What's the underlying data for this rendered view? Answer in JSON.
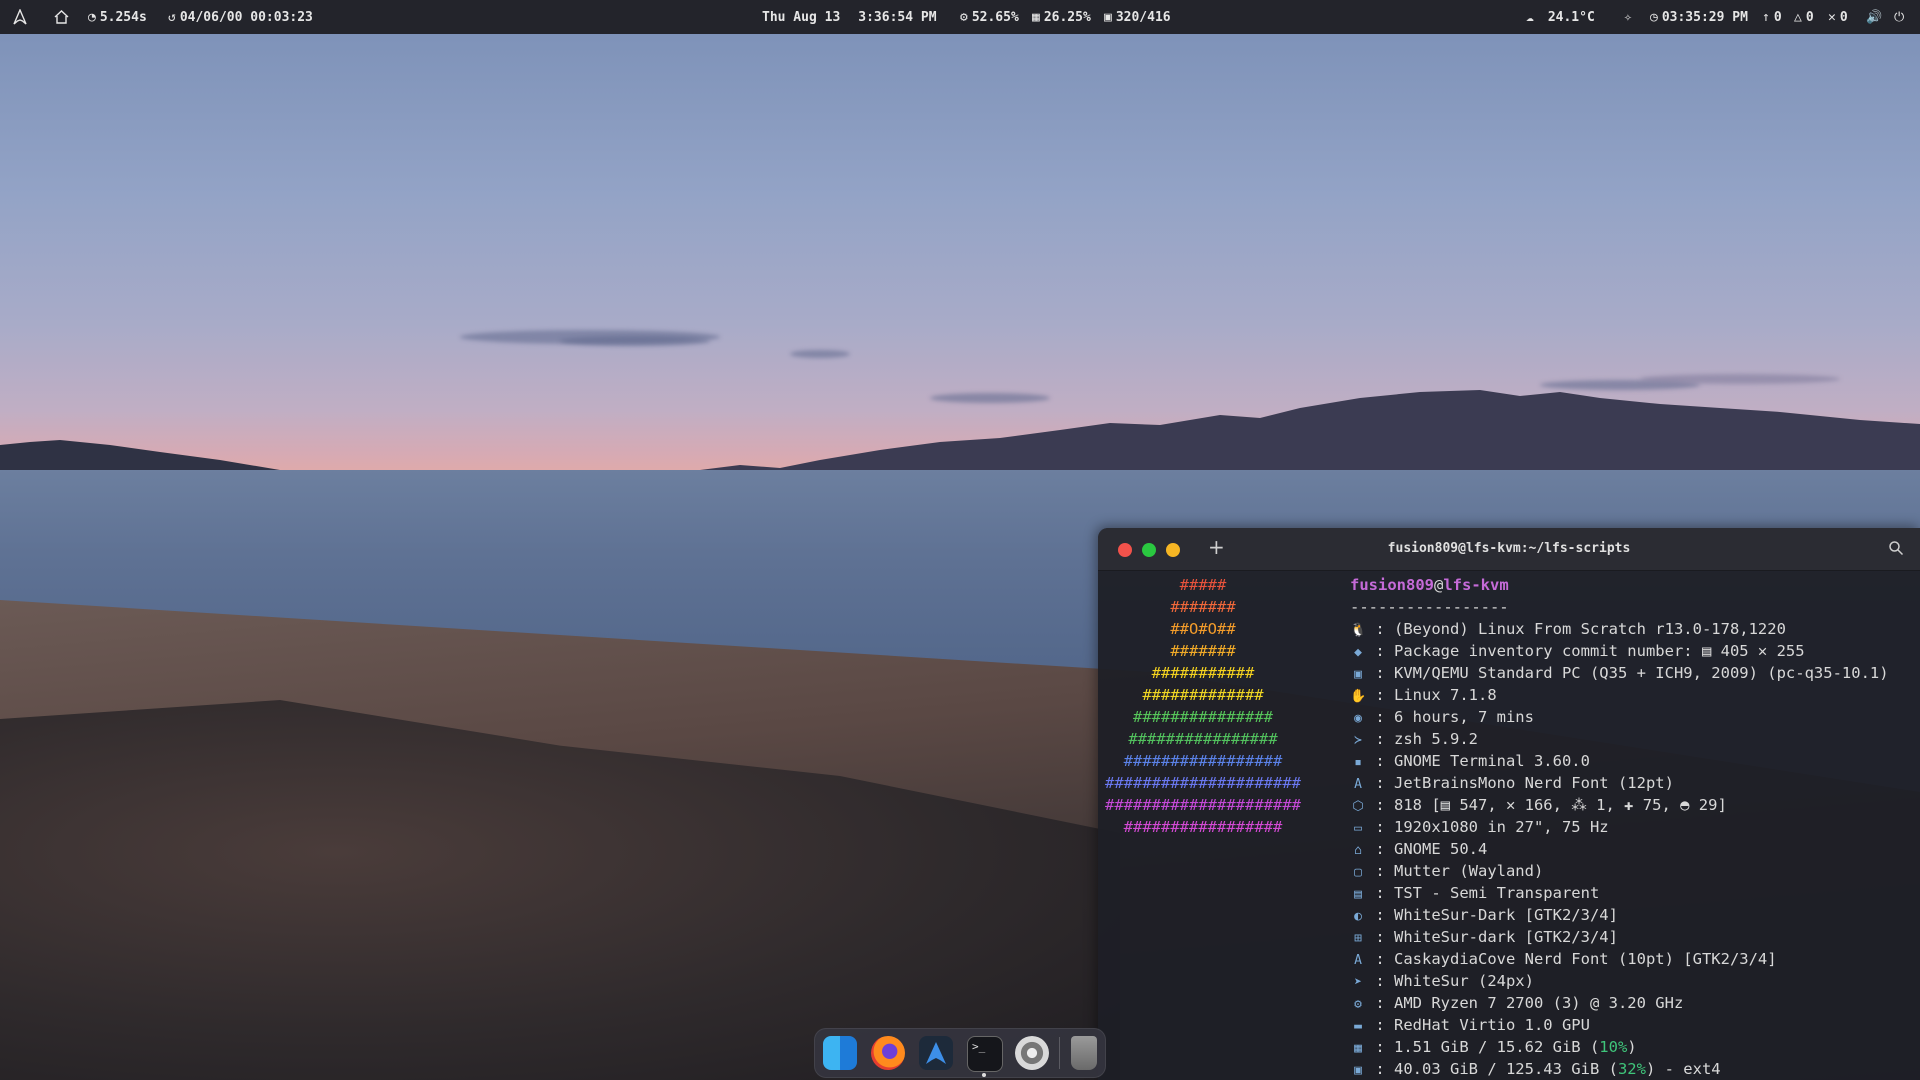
{
  "topbar": {
    "left": {
      "launcher_icon": "arch-linux-icon",
      "home_icon": "home-icon",
      "load_value": "5.254s",
      "uptime_value": "04/06/00 00:03:23"
    },
    "center": {
      "date": "Thu Aug 13",
      "time": "3:36:54 PM",
      "cpu": "52.65%",
      "memory": "26.25%",
      "disk": "320/416"
    },
    "right": {
      "weather": "24.1°C",
      "clock": "03:35:29 PM",
      "updates": "0",
      "warnings": "0",
      "errors": "0"
    }
  },
  "terminal": {
    "title": "fusion809@lfs-kvm:~/lfs-scripts",
    "ascii_logo": [
      {
        "text": "#####",
        "color": "#e8533c"
      },
      {
        "text": "#######",
        "color": "#f0683a"
      },
      {
        "text": "##O#O##",
        "color": "#f39c2a"
      },
      {
        "text": "#######",
        "color": "#f2ab28"
      },
      {
        "text": "###########",
        "color": "#f4d21f"
      },
      {
        "text": "#############",
        "color": "#f0d624"
      },
      {
        "text": "###############",
        "color": "#56c45a"
      },
      {
        "text": "################",
        "color": "#52c25e"
      },
      {
        "text": "#################",
        "color": "#5b82e8"
      },
      {
        "text": "#####################",
        "color": "#6a78f0"
      },
      {
        "text": "#####################",
        "color": "#c54ad8"
      },
      {
        "text": "#################",
        "color": "#d34ad4"
      }
    ],
    "user": "fusion809",
    "host": "lfs-kvm",
    "separator": "-----------------",
    "info": [
      {
        "icon": "linux-tux-icon",
        "glyph": "🐧",
        "text": " : (Beyond) Linux From Scratch r13.0-178,1220"
      },
      {
        "icon": "git-commit-icon",
        "glyph": "◆",
        "text": " : Package inventory commit number: ▤ 405 ✕ 255"
      },
      {
        "icon": "host-icon",
        "glyph": "▣",
        "text": " : KVM/QEMU Standard PC (Q35 + ICH9, 2009) (pc-q35-10.1)"
      },
      {
        "icon": "kernel-icon",
        "glyph": "✋",
        "text": " : Linux 7.1.8"
      },
      {
        "icon": "uptime-icon",
        "glyph": "◉",
        "text": " : 6 hours, 7 mins"
      },
      {
        "icon": "shell-icon",
        "glyph": "≻",
        "text": " : zsh 5.9.2"
      },
      {
        "icon": "terminal-icon",
        "glyph": "▪",
        "text": " : GNOME Terminal 3.60.0"
      },
      {
        "icon": "font-icon",
        "glyph": "A",
        "text": " : JetBrainsMono Nerd Font (12pt)"
      },
      {
        "icon": "packages-icon",
        "glyph": "⬡",
        "text": " : 818 [▤ 547, ✕ 166, ⁂ 1, ✚ 75, ◓ 29]"
      },
      {
        "icon": "display-icon",
        "glyph": "▭",
        "text": " : 1920x1080 in 27\", 75 Hz"
      },
      {
        "icon": "desktop-env-icon",
        "glyph": "⌂",
        "text": " : GNOME 50.4"
      },
      {
        "icon": "window-manager-icon",
        "glyph": "▢",
        "text": " : Mutter (Wayland)"
      },
      {
        "icon": "wm-theme-icon",
        "glyph": "▤",
        "text": " : TST - Semi Transparent"
      },
      {
        "icon": "theme-icon",
        "glyph": "◐",
        "text": " : WhiteSur-Dark [GTK2/3/4]"
      },
      {
        "icon": "icons-icon",
        "glyph": "⊞",
        "text": " : WhiteSur-dark [GTK2/3/4]"
      },
      {
        "icon": "font-icon",
        "glyph": "A",
        "text": " : CaskaydiaCove Nerd Font (10pt) [GTK2/3/4]"
      },
      {
        "icon": "cursor-icon",
        "glyph": "➤",
        "text": " : WhiteSur (24px)"
      },
      {
        "icon": "cpu-icon",
        "glyph": "⚙",
        "text": " : AMD Ryzen 7 2700 (3) @ 3.20 GHz"
      },
      {
        "icon": "gpu-icon",
        "glyph": "▬",
        "text": " : RedHat Virtio 1.0 GPU"
      }
    ],
    "memory": {
      "prefix": " : 1.51 GiB / 15.62 GiB (",
      "pct": "10%",
      "suffix": ")"
    },
    "disk": {
      "prefix": " : 40.03 GiB / 125.43 GiB (",
      "pct": "32%",
      "suffix": ") - ext4"
    }
  },
  "dock": {
    "apps": [
      {
        "name": "finder-icon"
      },
      {
        "name": "firefox-icon"
      },
      {
        "name": "arch-launcher-icon"
      },
      {
        "name": "terminal-icon"
      },
      {
        "name": "settings-icon"
      },
      {
        "name": "trash-icon"
      }
    ]
  }
}
